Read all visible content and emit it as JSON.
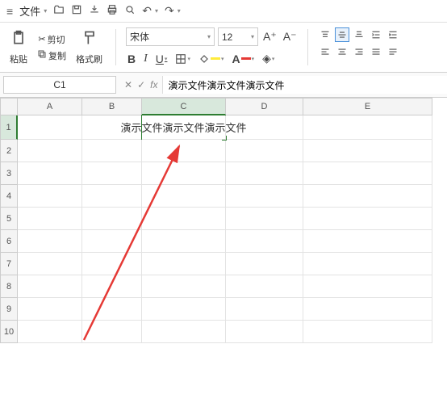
{
  "topbar": {
    "file_label": "文件",
    "icons": [
      "open-icon",
      "save-icon",
      "export-icon",
      "print-icon",
      "preview-icon",
      "undo-icon",
      "redo-icon"
    ]
  },
  "ribbon": {
    "paste_label": "粘贴",
    "cut_label": "剪切",
    "copy_label": "复制",
    "format_painter_label": "格式刷",
    "font_name": "宋体",
    "font_size": "12",
    "increase_font": "A⁺",
    "decrease_font": "A⁻",
    "bold": "B",
    "italic": "I",
    "underline": "U"
  },
  "formula_bar": {
    "name_box": "C1",
    "fx_label": "fx",
    "content": "演示文件演示文件演示文件"
  },
  "columns": [
    "A",
    "B",
    "C",
    "D",
    "E"
  ],
  "rows": [
    "1",
    "2",
    "3",
    "4",
    "5",
    "6",
    "7",
    "8",
    "9",
    "10"
  ],
  "cells": {
    "C1": "演示文件演示文件演示文件"
  }
}
